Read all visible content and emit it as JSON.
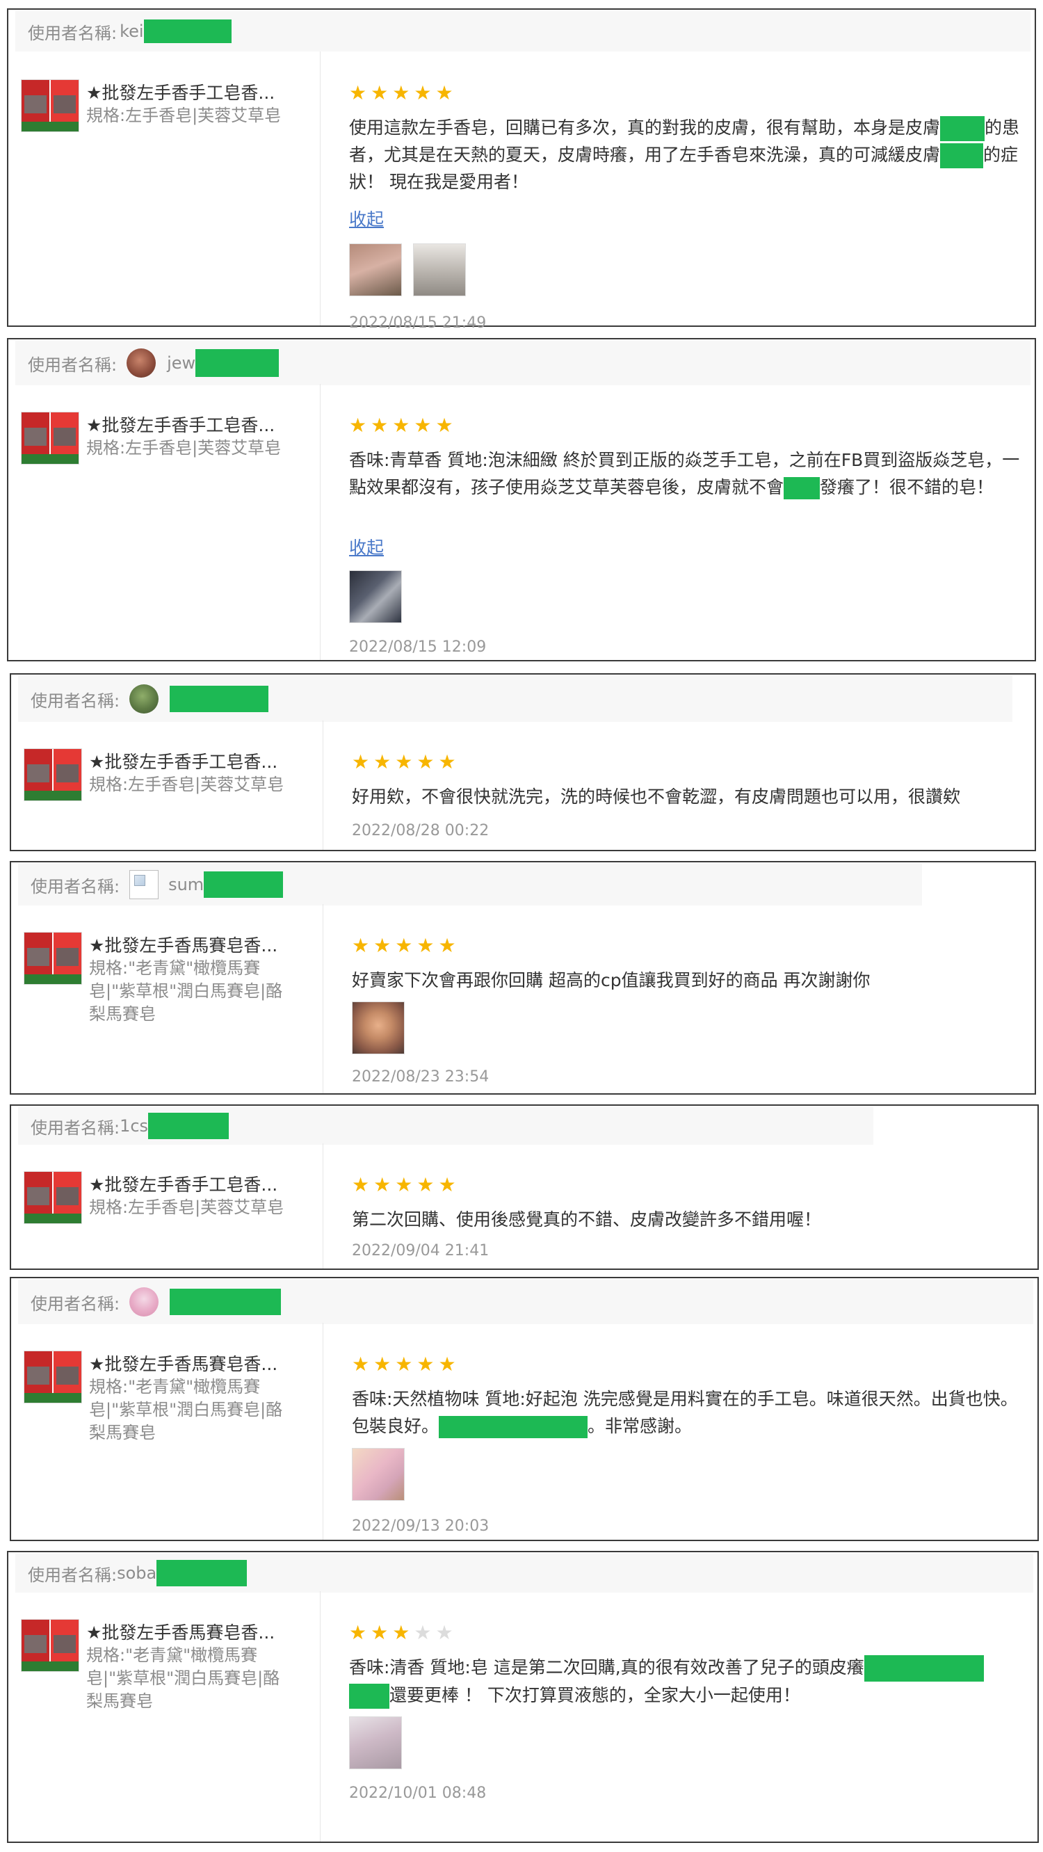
{
  "reviews": [
    {
      "user_prefix": "使用者名稱:",
      "user_name": "kei",
      "product_title": "★批發左手香手工皂香...",
      "product_spec": "規格:左手香皂|芙蓉艾草皂",
      "rating": 5,
      "comment_parts": [
        "使用這款左手香皂，回購已有多次，真的對我的皮膚，很有幫助，本身是皮膚",
        "的患者，尤其是在天熱的夏天，皮膚時癢，用了左手香皂來洗澡，真的可減緩皮膚",
        "的症狀！ 現在我是愛用者！"
      ],
      "collapse_label": "收起",
      "date": "2022/08/15 21:49"
    },
    {
      "user_prefix": "使用者名稱:",
      "user_name": "jew",
      "product_title": "★批發左手香手工皂香...",
      "product_spec": "規格:左手香皂|芙蓉艾草皂",
      "rating": 5,
      "comment_parts": [
        "香味:青草香 質地:泡沫細緻 終於買到正版的焱芝手工皂，之前在FB買到盜版焱芝皂，一點效果都沒有，孩子使用焱芝艾草芙蓉皂後，皮膚就不會",
        "發癢了！很不錯的皂！"
      ],
      "collapse_label": "收起",
      "date": "2022/08/15 12:09"
    },
    {
      "user_prefix": "使用者名稱:",
      "user_name": "",
      "product_title": "★批發左手香手工皂香...",
      "product_spec": "規格:左手香皂|芙蓉艾草皂",
      "rating": 5,
      "comment_parts": [
        "好用欸，不會很快就洗完，洗的時候也不會乾澀，有皮膚問題也可以用，很讚欸"
      ],
      "date": "2022/08/28 00:22"
    },
    {
      "user_prefix": "使用者名稱:",
      "user_name": "sum",
      "product_title": "★批發左手香馬賽皂香...",
      "product_spec": "規格:\"老青黛\"橄欖馬賽皂|\"紫草根\"潤白馬賽皂|酪梨馬賽皂",
      "rating": 5,
      "comment_parts": [
        "好賣家下次會再跟你回購 超高的cp值讓我買到好的商品 再次謝謝你"
      ],
      "date": "2022/08/23 23:54"
    },
    {
      "user_prefix": "使用者名稱:",
      "user_name": "1cs",
      "product_title": "★批發左手香手工皂香...",
      "product_spec": "規格:左手香皂|芙蓉艾草皂",
      "rating": 5,
      "comment_parts": [
        "第二次回購、使用後感覺真的不錯、皮膚改變許多不錯用喔！"
      ],
      "date": "2022/09/04 21:41"
    },
    {
      "user_prefix": "使用者名稱:",
      "user_name": "",
      "product_title": "★批發左手香馬賽皂香...",
      "product_spec": "規格:\"老青黛\"橄欖馬賽皂|\"紫草根\"潤白馬賽皂|酪梨馬賽皂",
      "rating": 5,
      "comment_parts": [
        "香味:天然植物味 質地:好起泡 洗完感覺是用料實在的手工皂。味道很天然。出貨也快。包裝良好。",
        "。非常感謝。"
      ],
      "date": "2022/09/13 20:03"
    },
    {
      "user_prefix": "使用者名稱:",
      "user_name": "soba",
      "product_title": "★批發左手香馬賽皂香...",
      "product_spec": "規格:\"老青黛\"橄欖馬賽皂|\"紫草根\"潤白馬賽皂|酪梨馬賽皂",
      "rating": 3,
      "comment_parts": [
        "香味:清香 質地:皂 這是第二次回購,真的很有效改善了兒子的頭皮癢",
        "還要更棒 ！ 下次打算買液態的，全家大小一起使用！"
      ],
      "date": "2022/10/01 08:48"
    }
  ],
  "colors": {
    "star": "#f7b500",
    "star_empty": "#dcdcdc",
    "link": "#4a79c9",
    "redaction": "#1db954"
  }
}
